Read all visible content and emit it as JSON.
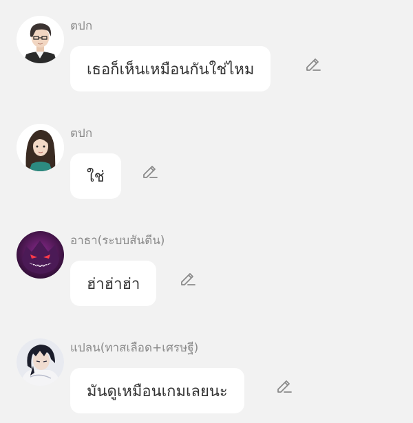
{
  "colors": {
    "background": "#f2f2f2",
    "bubble": "#ffffff",
    "name_text": "#8a8a8a",
    "message_text": "#333333",
    "edit_icon": "#8a8a8a"
  },
  "messages": [
    {
      "sender": "ตปก",
      "text": "เธอก็เห็นเหมือนกันใช่ไหม",
      "avatar_icon": "male-character-avatar",
      "action_icon": "pencil-edit-icon"
    },
    {
      "sender": "ตปก",
      "text": "ใช่",
      "avatar_icon": "female-character-avatar",
      "action_icon": "pencil-edit-icon"
    },
    {
      "sender": "อาธา(ระบบสันตีน)",
      "text": "ฮ่าฮ่าฮ่า",
      "avatar_icon": "purple-ghost-avatar",
      "action_icon": "pencil-edit-icon"
    },
    {
      "sender": "แปลน(ทาสเลือด+เศรษฐี)",
      "text": "มันดูเหมือนเกมเลยนะ",
      "avatar_icon": "dark-haired-character-avatar",
      "action_icon": "pencil-edit-icon"
    }
  ]
}
